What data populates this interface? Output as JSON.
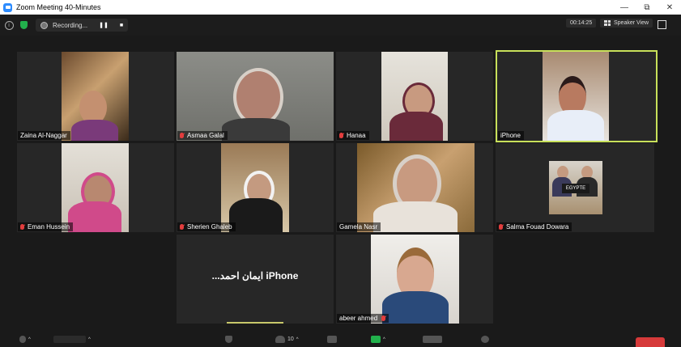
{
  "window": {
    "title": "Zoom Meeting 40-Minutes",
    "minimize": "—",
    "maximize": "⧉",
    "close": "✕"
  },
  "infobar": {
    "recording_label": "Recording...",
    "pause": "❚❚",
    "stop": "■",
    "timer": "00:14:25",
    "speaker_view_label": "Speaker View"
  },
  "participants": [
    {
      "name": "Zaina Al-Naggar",
      "muted": false
    },
    {
      "name": "Asmaa Galal",
      "muted": true
    },
    {
      "name": "Hanaa",
      "muted": true
    },
    {
      "name": "iPhone",
      "muted": false,
      "active": true
    },
    {
      "name": "Eman Hussein",
      "muted": true
    },
    {
      "name": "Sherien Ghaleb",
      "muted": true
    },
    {
      "name": "Gamela Nasr",
      "muted": false
    },
    {
      "name": "Salma Fouad Dowara",
      "muted": true
    },
    {
      "name": "...ايمان احمد iPhone",
      "video": false
    },
    {
      "name": "abeer ahmed",
      "muted": true
    }
  ],
  "salma_sign": "EGYPTE",
  "toolbar": {
    "participants_count": "10"
  },
  "colors": {
    "active_speaker": "#c8e05a",
    "muted_icon": "#e23d3d",
    "end_button": "#d63a3a",
    "security_shield": "#22b14c"
  }
}
